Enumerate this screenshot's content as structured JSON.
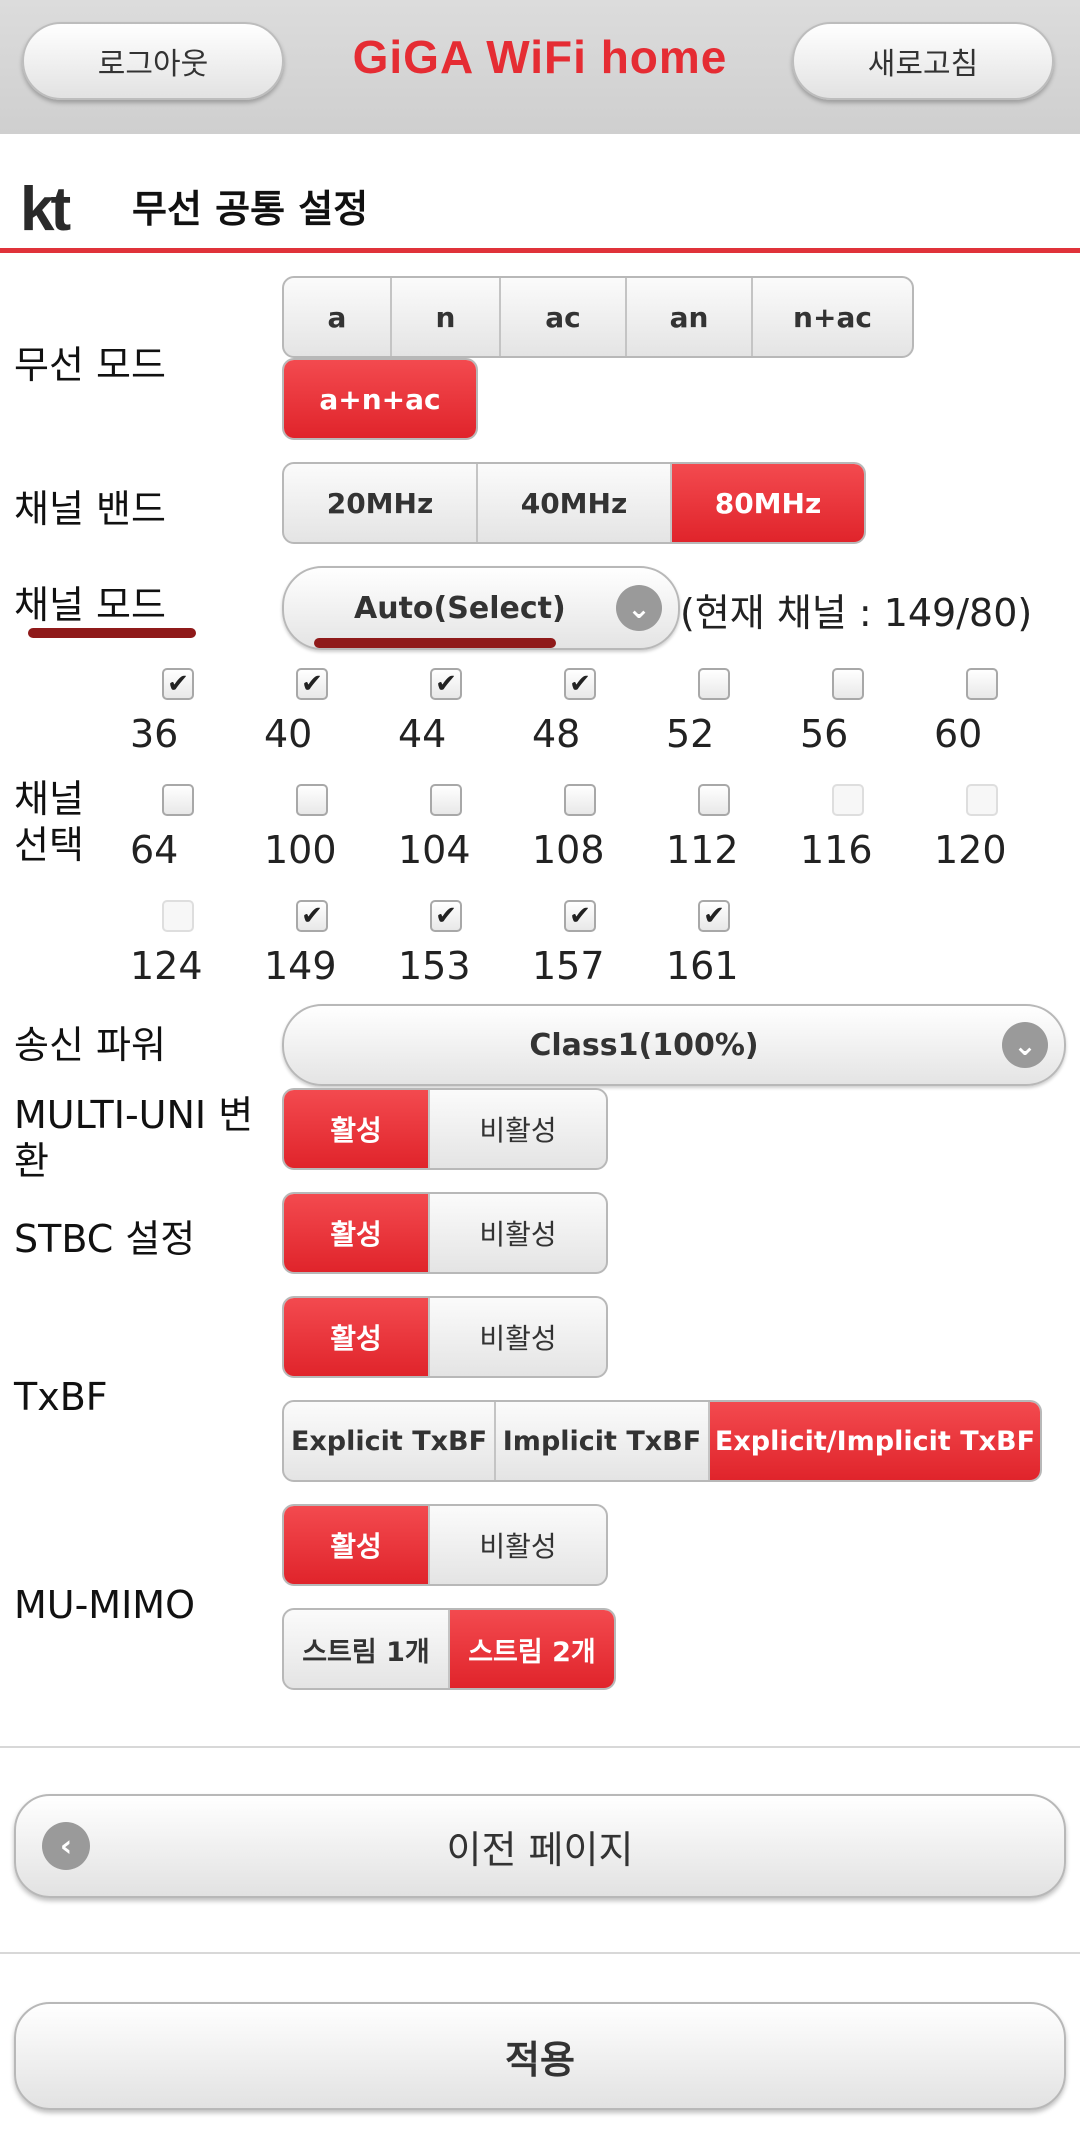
{
  "header": {
    "logout_label": "로그아웃",
    "app_title": "GiGA WiFi home",
    "refresh_label": "새로고침"
  },
  "titlebar": {
    "logo": "kt",
    "title": "무선 공통 설정"
  },
  "wireless_mode": {
    "label": "무선 모드",
    "options": [
      "a",
      "n",
      "ac",
      "an",
      "n+ac",
      "a+n+ac"
    ],
    "selected": "a+n+ac"
  },
  "channel_band": {
    "label": "채널 밴드",
    "options": [
      "20MHz",
      "40MHz",
      "80MHz"
    ],
    "selected": "80MHz"
  },
  "channel_mode": {
    "label": "채널 모드",
    "value": "Auto(Select)",
    "current_channel": "(현재 채널 : 149/80)"
  },
  "channel_select": {
    "label_line1": "채널",
    "label_line2": "선택",
    "channels": [
      {
        "n": "36",
        "checked": true,
        "disabled": false
      },
      {
        "n": "40",
        "checked": true,
        "disabled": false
      },
      {
        "n": "44",
        "checked": true,
        "disabled": false
      },
      {
        "n": "48",
        "checked": true,
        "disabled": false
      },
      {
        "n": "52",
        "checked": false,
        "disabled": false
      },
      {
        "n": "56",
        "checked": false,
        "disabled": false
      },
      {
        "n": "60",
        "checked": false,
        "disabled": false
      },
      {
        "n": "64",
        "checked": false,
        "disabled": false
      },
      {
        "n": "100",
        "checked": false,
        "disabled": false
      },
      {
        "n": "104",
        "checked": false,
        "disabled": false
      },
      {
        "n": "108",
        "checked": false,
        "disabled": false
      },
      {
        "n": "112",
        "checked": false,
        "disabled": false
      },
      {
        "n": "116",
        "checked": false,
        "disabled": true
      },
      {
        "n": "120",
        "checked": false,
        "disabled": true
      },
      {
        "n": "124",
        "checked": false,
        "disabled": true
      },
      {
        "n": "149",
        "checked": true,
        "disabled": false
      },
      {
        "n": "153",
        "checked": true,
        "disabled": false
      },
      {
        "n": "157",
        "checked": true,
        "disabled": false
      },
      {
        "n": "161",
        "checked": true,
        "disabled": false
      }
    ]
  },
  "tx_power": {
    "label": "송신 파워",
    "value": "Class1(100%)"
  },
  "toggle_labels": {
    "on": "활성",
    "off": "비활성"
  },
  "multi_uni": {
    "label_line1": "MULTI-UNI 변",
    "label_line2": "환",
    "state": "on"
  },
  "stbc": {
    "label": "STBC 설정",
    "state": "on"
  },
  "txbf": {
    "label": "TxBF",
    "state": "on",
    "types": [
      "Explicit TxBF",
      "Implicit TxBF",
      "Explicit/Implicit TxBF"
    ],
    "selected": "Explicit/Implicit TxBF"
  },
  "mu_mimo": {
    "label": "MU-MIMO",
    "state": "on",
    "streams": [
      "스트림 1개",
      "스트림 2개"
    ],
    "selected": "스트림 2개"
  },
  "footer": {
    "prev_label": "이전 페이지",
    "apply_label": "적용"
  },
  "colors": {
    "accent": "#e52c33",
    "button_gray": "#e4e4e4"
  }
}
